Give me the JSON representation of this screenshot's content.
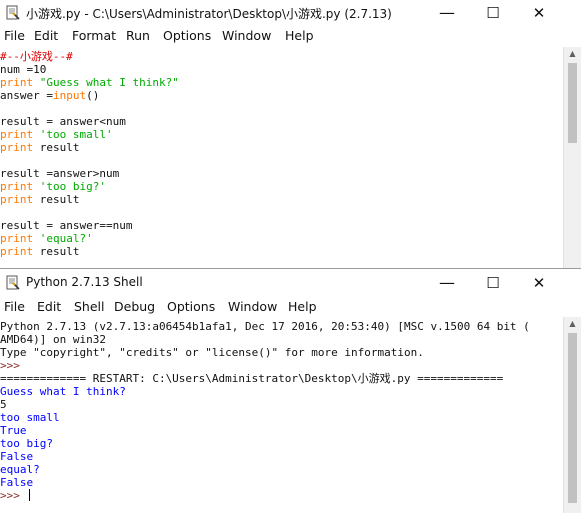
{
  "editor": {
    "title": "小游戏.py - C:\\Users\\Administrator\\Desktop\\小游戏.py (2.7.13)",
    "menu": [
      "File",
      "Edit",
      "Format",
      "Run",
      "Options",
      "Window",
      "Help"
    ],
    "code": {
      "l1": "#--小游戏--#",
      "l2_a": "num =10",
      "l3_kw": "print",
      "l3_str": "\"Guess what I think?\"",
      "l4_a": "answer =",
      "l4_kw": "input",
      "l4_b": "()",
      "l6": "result = answer<num",
      "l7_kw": "print",
      "l7_str": "'too small'",
      "l8_kw": "print",
      "l8_b": "result",
      "l10": "result =answer>num",
      "l11_kw": "print",
      "l11_str": "'too big?'",
      "l12_kw": "print",
      "l12_b": "result",
      "l14": "result = answer==num",
      "l15_kw": "print",
      "l15_str": "'equal?'",
      "l16_kw": "print",
      "l16_b": "result"
    }
  },
  "shell": {
    "title": "Python 2.7.13 Shell",
    "menu": [
      "File",
      "Edit",
      "Shell",
      "Debug",
      "Options",
      "Window",
      "Help"
    ],
    "lines": {
      "l1": "Python 2.7.13 (v2.7.13:a06454b1afa1, Dec 17 2016, 20:53:40) [MSC v.1500 64 bit (",
      "l2": "AMD64)] on win32",
      "l3": "Type \"copyright\", \"credits\" or \"license()\" for more information.",
      "l4": ">>> ",
      "l5": "============= RESTART: C:\\Users\\Administrator\\Desktop\\小游戏.py =============",
      "l6": "Guess what I think?",
      "l7": "5",
      "l8": "too small",
      "l9": "True",
      "l10": "too big?",
      "l11": "False",
      "l12": "equal?",
      "l13": "False",
      "l14": ">>> "
    }
  },
  "window_controls": {
    "minimize": "—",
    "maximize": "☐",
    "close": "✕"
  },
  "colors": {
    "keyword": "#ff7700",
    "string": "#00aa00",
    "comment": "#dd0000",
    "output": "#0000ff"
  }
}
